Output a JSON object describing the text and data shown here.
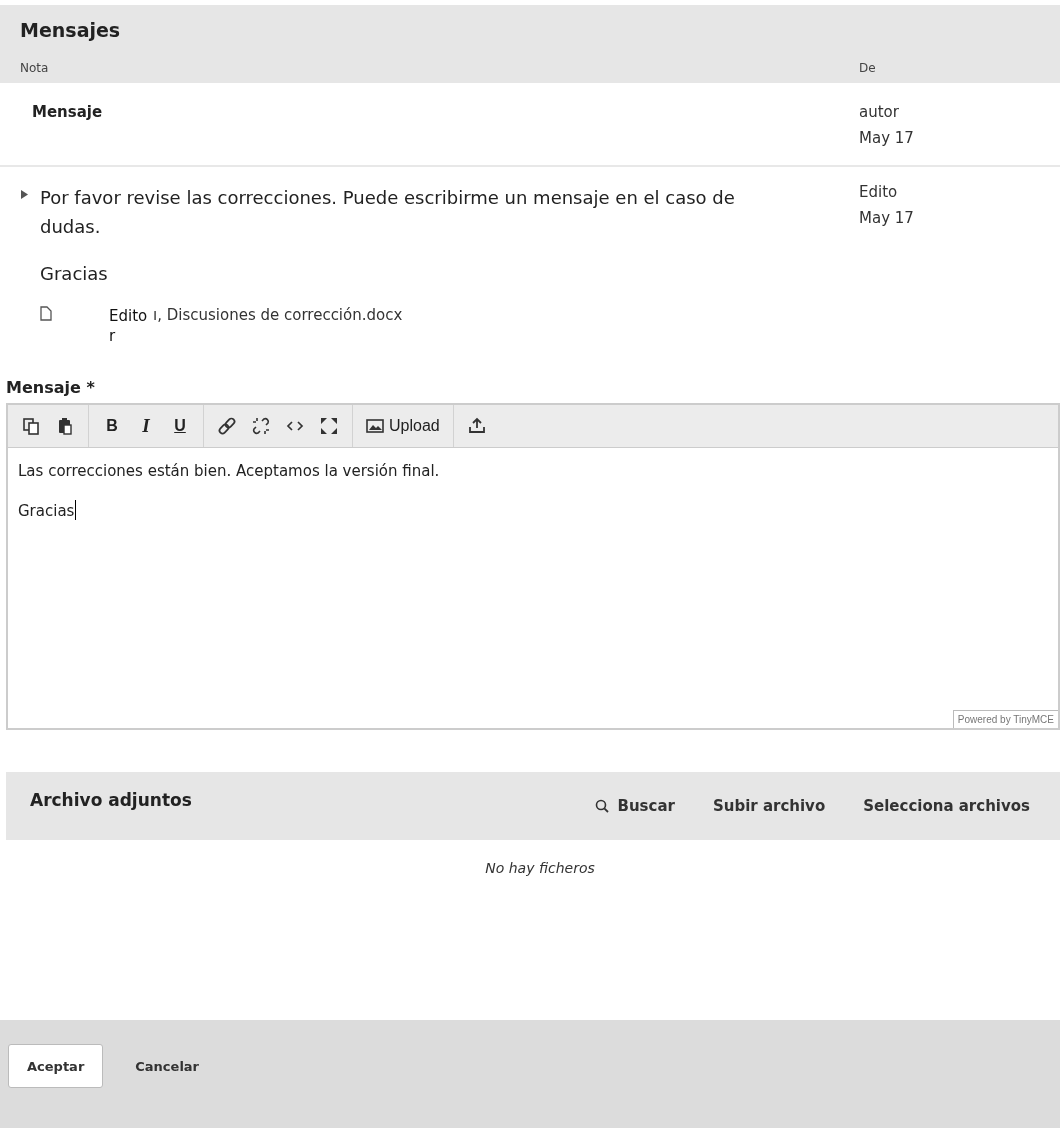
{
  "messages": {
    "title": "Mensajes",
    "columns": [
      "Nota",
      "De"
    ],
    "rows": [
      {
        "kind": "heading",
        "note": "Mensaje",
        "from": "autor",
        "date": "May 17"
      },
      {
        "kind": "message",
        "expanded": false,
        "note": "Por favor revise las correcciones. Puede escribirme un mensaje en el caso de dudas.",
        "closing": "Gracias",
        "attachment": {
          "author": "Edito r",
          "file": "ı, Discusiones de corrección.docx"
        },
        "from": "Edito",
        "date": "May 17"
      }
    ]
  },
  "editor": {
    "label": "Mensaje *",
    "toolbar": [
      [
        {
          "kind": "copy"
        },
        {
          "kind": "paste"
        }
      ],
      [
        {
          "kind": "bold",
          "label": "B"
        },
        {
          "kind": "italic",
          "label": "I"
        },
        {
          "kind": "underline",
          "label": "U"
        }
      ],
      [
        {
          "kind": "link"
        },
        {
          "kind": "unlink"
        },
        {
          "kind": "code"
        },
        {
          "kind": "fullscreen"
        }
      ],
      [
        {
          "kind": "image",
          "label": "Upload"
        }
      ],
      [
        {
          "kind": "upload"
        }
      ]
    ],
    "paragraphs": [
      "Las correcciones están bien. Aceptamos la versión final.",
      "Gracias"
    ],
    "branding": "Powered by TinyMCE"
  },
  "attachments": {
    "title": "Archivo adjuntos",
    "actions": [
      {
        "kind": "search",
        "label": "Buscar"
      },
      {
        "kind": "plain",
        "label": "Subir archivo"
      },
      {
        "kind": "plain",
        "label": "Selecciona archivos"
      }
    ],
    "empty": "No hay ficheros"
  },
  "footer": {
    "buttons": [
      {
        "kind": "primary",
        "label": "Aceptar"
      },
      {
        "kind": "secondary",
        "label": "Cancelar"
      }
    ]
  }
}
